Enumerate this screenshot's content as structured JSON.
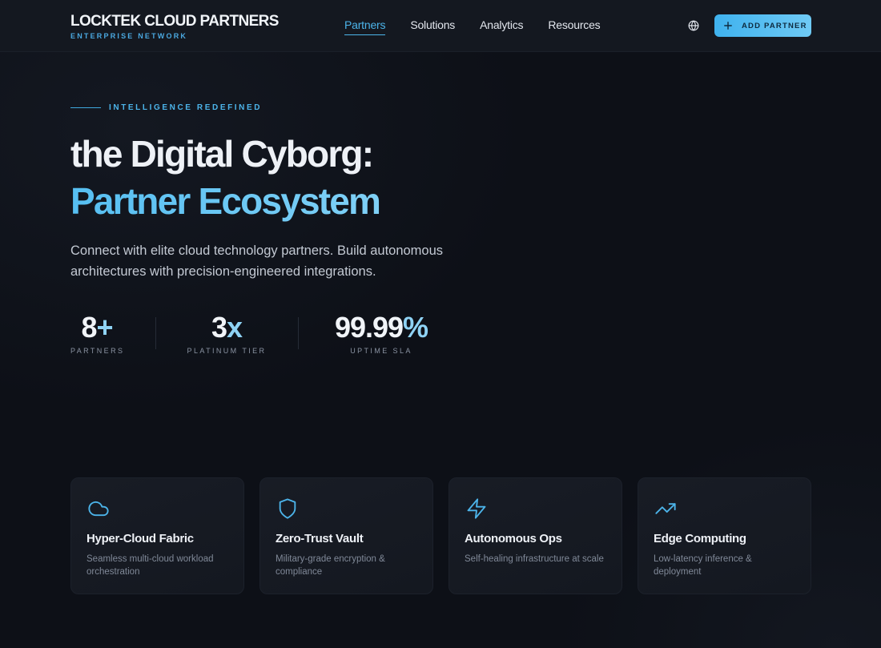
{
  "header": {
    "brand_title": "LOCKTEK CLOUD PARTNERS",
    "brand_subtitle": "ENTERPRISE NETWORK",
    "nav": [
      {
        "label": "Partners",
        "active": true
      },
      {
        "label": "Solutions",
        "active": false
      },
      {
        "label": "Analytics",
        "active": false
      },
      {
        "label": "Resources",
        "active": false
      }
    ],
    "globe_icon": "globe-icon",
    "add_button_label": "ADD PARTNER",
    "add_button_icon": "plus-icon"
  },
  "hero": {
    "eyebrow": "INTELLIGENCE REDEFINED",
    "title_line1": "the Digital Cyborg:",
    "title_line2": "Partner Ecosystem",
    "description": "Connect with elite cloud technology partners. Build autonomous architectures with precision-engineered integrations.",
    "stats": [
      {
        "main": "8",
        "accent": "+",
        "label": "PARTNERS"
      },
      {
        "main": "3",
        "accent": "x",
        "label": "PLATINUM TIER"
      },
      {
        "main": "99.99",
        "accent": "%",
        "label": "UPTIME SLA"
      }
    ]
  },
  "features": [
    {
      "icon": "cloud-icon",
      "title": "Hyper-Cloud Fabric",
      "description": "Seamless multi-cloud workload orchestration"
    },
    {
      "icon": "shield-icon",
      "title": "Zero-Trust Vault",
      "description": "Military-grade encryption & compliance"
    },
    {
      "icon": "lightning-icon",
      "title": "Autonomous Ops",
      "description": "Self-healing infrastructure at scale"
    },
    {
      "icon": "trending-up-icon",
      "title": "Edge Computing",
      "description": "Low-latency inference & deployment"
    }
  ],
  "colors": {
    "accent": "#4cb4ea",
    "background": "#0d1017",
    "card": "#161a22"
  }
}
